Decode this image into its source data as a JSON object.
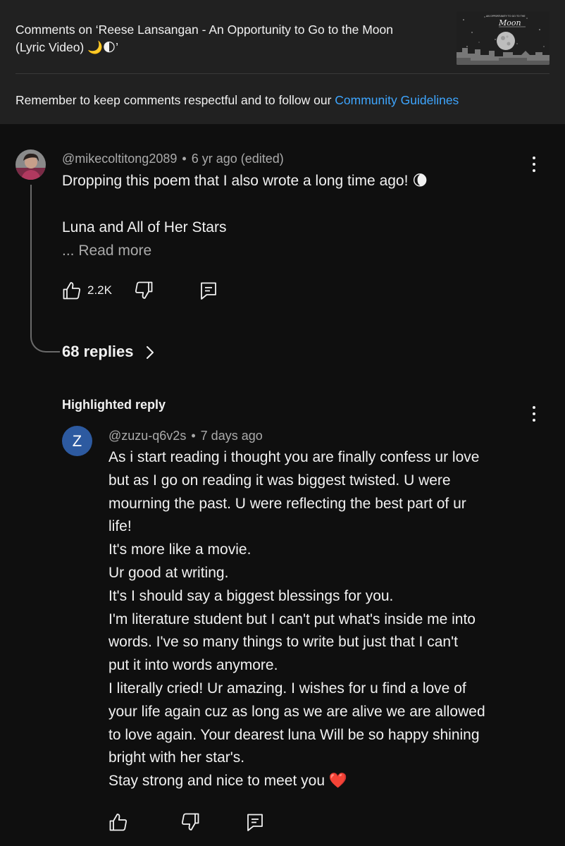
{
  "header": {
    "title_line1": "Comments on ‘Reese Lansangan - An Opportunity to Go to the Moon",
    "title_line2": "(Lyric Video) 🌙🌓’",
    "guidelines_text": "Remember to keep comments respectful and to follow our ",
    "guidelines_link": "Community Guidelines"
  },
  "thumbnail": {
    "tiny_text": "AN OPPORTUNITY TO GO TO THE",
    "script_text": "Moon"
  },
  "comment": {
    "author": "@mikecoltitong2089",
    "separator": "•",
    "time": "6 yr ago (edited)",
    "line1": "Dropping this poem that I also wrote a long time ago! 🌘",
    "line2": "Luna and All of Her Stars",
    "read_more": "... Read more",
    "like_count": "2.2K",
    "replies_label": "68 replies"
  },
  "highlighted": {
    "label": "Highlighted reply",
    "avatar_letter": "Z",
    "author": "@zuzu-q6v2s",
    "separator": "•",
    "time": "7 days ago",
    "lines": [
      "As i start reading i thought you are finally confess ur love",
      "but as I go on reading it was biggest twisted. U were",
      "mourning the past. U were reflecting the best part of ur",
      "life!",
      "It's more like a movie.",
      "Ur good at writing.",
      "It's I should say a biggest blessings for you.",
      "I'm literature student but I can't put what's inside me into",
      "words. I've so many things to write but just that I can't",
      "put it into words anymore.",
      "I literally cried! Ur amazing. I wishes for u find a love of",
      "your life again cuz as long as we are alive we are allowed",
      "to love again. Your dearest luna Will be so happy shining",
      "bright with her star's.",
      "Stay strong and nice to meet you ❤️"
    ]
  },
  "colors": {
    "background": "#0f0f0f",
    "header_bg": "#212121",
    "link": "#3ea6ff",
    "secondary_text": "#aaaaaa",
    "avatar_z": "#2d5aa0"
  },
  "icons": [
    "kebab-icon",
    "like-icon",
    "dislike-icon",
    "reply-icon",
    "chevron-right-icon"
  ]
}
